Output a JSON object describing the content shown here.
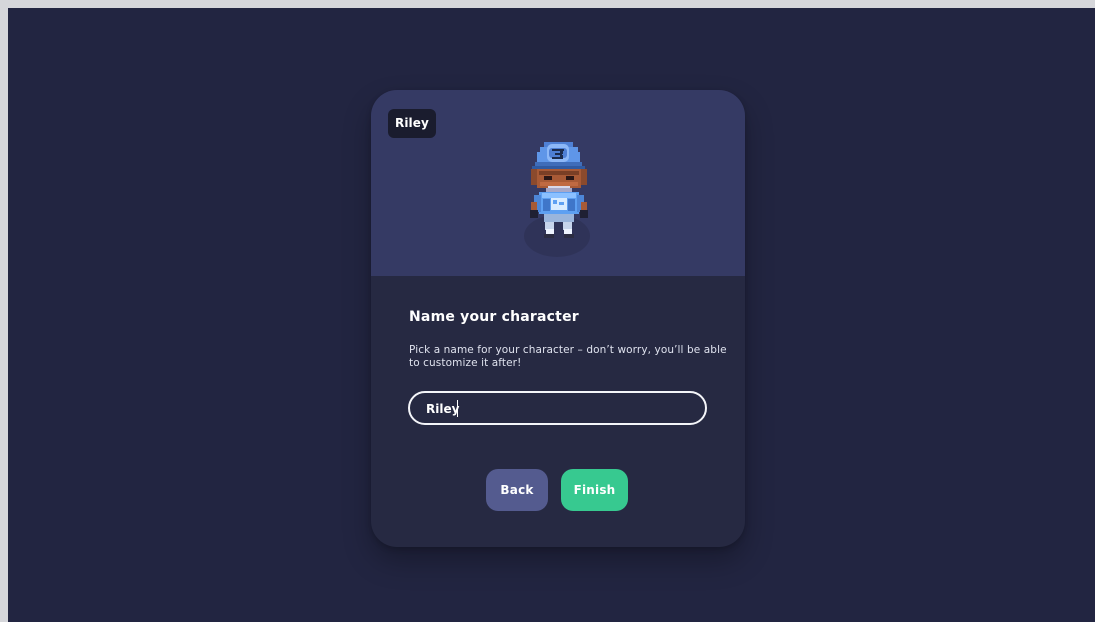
{
  "window": {
    "background": "#222541"
  },
  "card": {
    "preview": {
      "character_name": "Riley",
      "character_icon": "pixel-character-blue-cap-icon"
    },
    "title": "Name your character",
    "description": "Pick a name for your character – don’t worry, you’ll be able to customize it after!",
    "name_input": {
      "value": "Riley",
      "placeholder": ""
    },
    "buttons": {
      "back_label": "Back",
      "finish_label": "Finish"
    }
  },
  "colors": {
    "accent": "#37c990",
    "secondary_button": "#545b8f",
    "preview_background": "#353a64",
    "card_background": "#262942"
  }
}
